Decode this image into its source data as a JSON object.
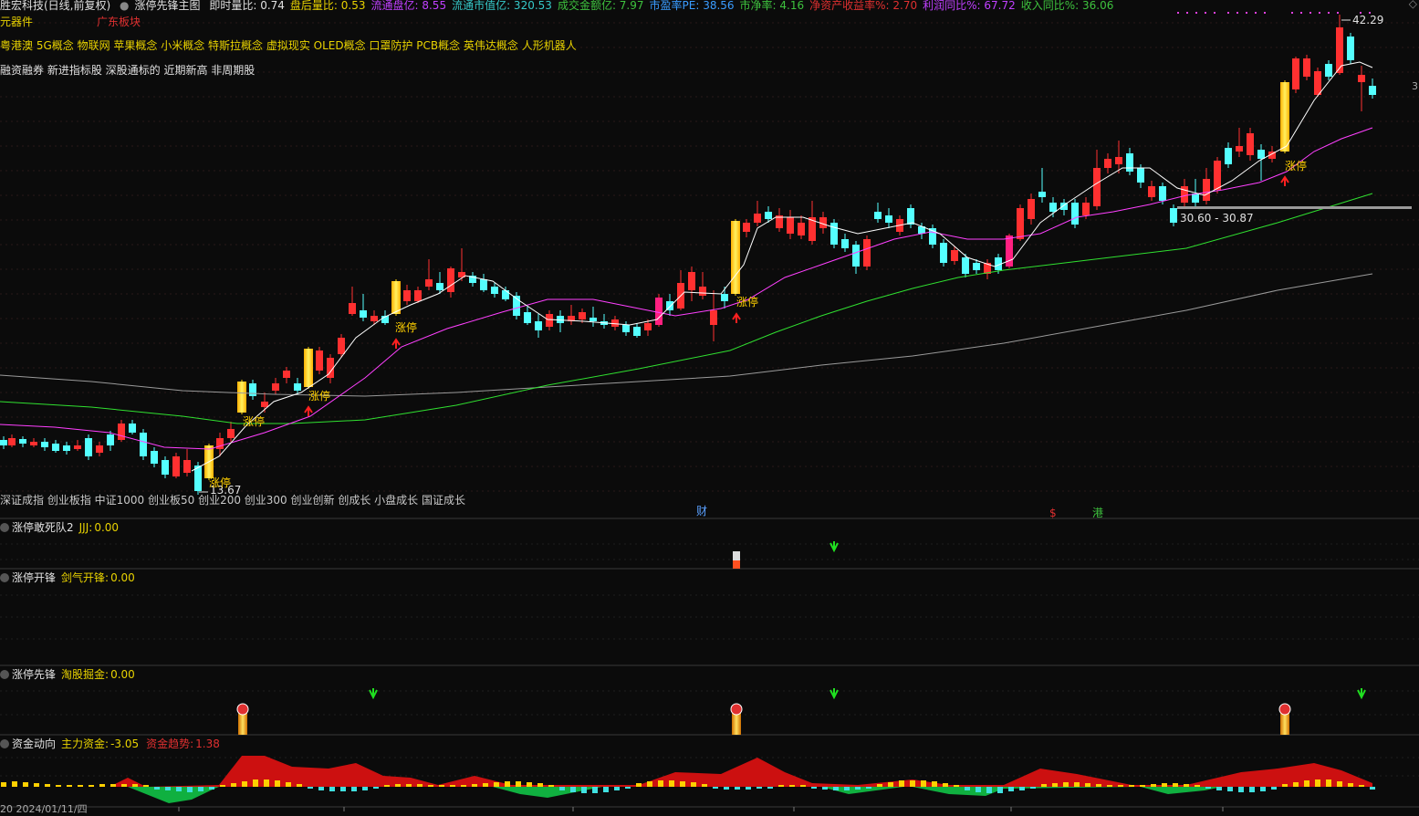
{
  "header": {
    "stock": "胜宏科技(日线,前复权)",
    "indicator": "涨停先锋主图",
    "fields": [
      {
        "label": "即时量比:",
        "value": "0.74",
        "color": "#e0e0e0"
      },
      {
        "label": "盘后量比:",
        "value": "0.53",
        "color": "#e8d200"
      },
      {
        "label": "流通盘亿:",
        "value": "8.55",
        "color": "#c040ff"
      },
      {
        "label": "流通市值亿:",
        "value": "320.53",
        "color": "#36c9c9"
      },
      {
        "label": "成交金额亿:",
        "value": "7.97",
        "color": "#3ec23e"
      },
      {
        "label": "市盈率PE:",
        "value": "38.56",
        "color": "#3a9cff"
      },
      {
        "label": "市净率:",
        "value": "4.16",
        "color": "#3ec23e"
      },
      {
        "label": "净资产收益率%:",
        "value": "2.70",
        "color": "#e03030"
      },
      {
        "label": "利润同比%:",
        "value": "67.72",
        "color": "#c040ff"
      },
      {
        "label": "收入同比%:",
        "value": "36.06",
        "color": "#3ec23e"
      }
    ],
    "corner_icon": "diamond-icon"
  },
  "sector": {
    "industry": "元器件",
    "region": "广东板块"
  },
  "concepts": "粤港澳 5G概念 物联网 苹果概念 小米概念 特斯拉概念 虚拟现实 OLED概念 口罩防护 PCB概念 英伟达概念 人形机器人",
  "tags": "融资融券 新进指标股 深股通标的 近期新高 非周期股",
  "indices": "深证成指 创业板指 中证1000 创业板50 创业200 创业300 创业创新 创成长 小盘成长 国证成长",
  "price_labels": {
    "high": "42.29",
    "low": "13.67",
    "range": "30.60 - 30.87",
    "right_edge": "3"
  },
  "limit_up_label": "涨停",
  "event_markers": [
    {
      "text": "财",
      "color": "#5aa0ff"
    },
    {
      "text": "$",
      "color": "#e03030"
    },
    {
      "text": "港",
      "color": "#3ec23e"
    }
  ],
  "panels": [
    {
      "name": "涨停敢死队2",
      "items": [
        {
          "label": "JJJ:",
          "value": "0.00",
          "color": "#e8d200"
        }
      ]
    },
    {
      "name": "涨停开锋",
      "items": [
        {
          "label": "剑气开锋:",
          "value": "0.00",
          "color": "#e8d200"
        }
      ]
    },
    {
      "name": "涨停先锋",
      "items": [
        {
          "label": "淘股掘金:",
          "value": "0.00",
          "color": "#e8d200"
        }
      ]
    },
    {
      "name": "资金动向",
      "items": [
        {
          "label": "主力资金:",
          "value": "-3.05",
          "color": "#e8d200"
        },
        {
          "label": "资金趋势:",
          "value": "1.38",
          "color": "#e03030"
        }
      ]
    }
  ],
  "date_label": "20 2024/01/11/四",
  "colors": {
    "up": "#ff3030",
    "down": "#54ffff",
    "limit": "#ffe000",
    "ma5": "#ffffff",
    "ma10": "#ff40ff",
    "ma30": "#30e030",
    "ma60": "#9a9a9a",
    "flow_up": "#cc1010",
    "flow_down": "#10b040"
  }
}
